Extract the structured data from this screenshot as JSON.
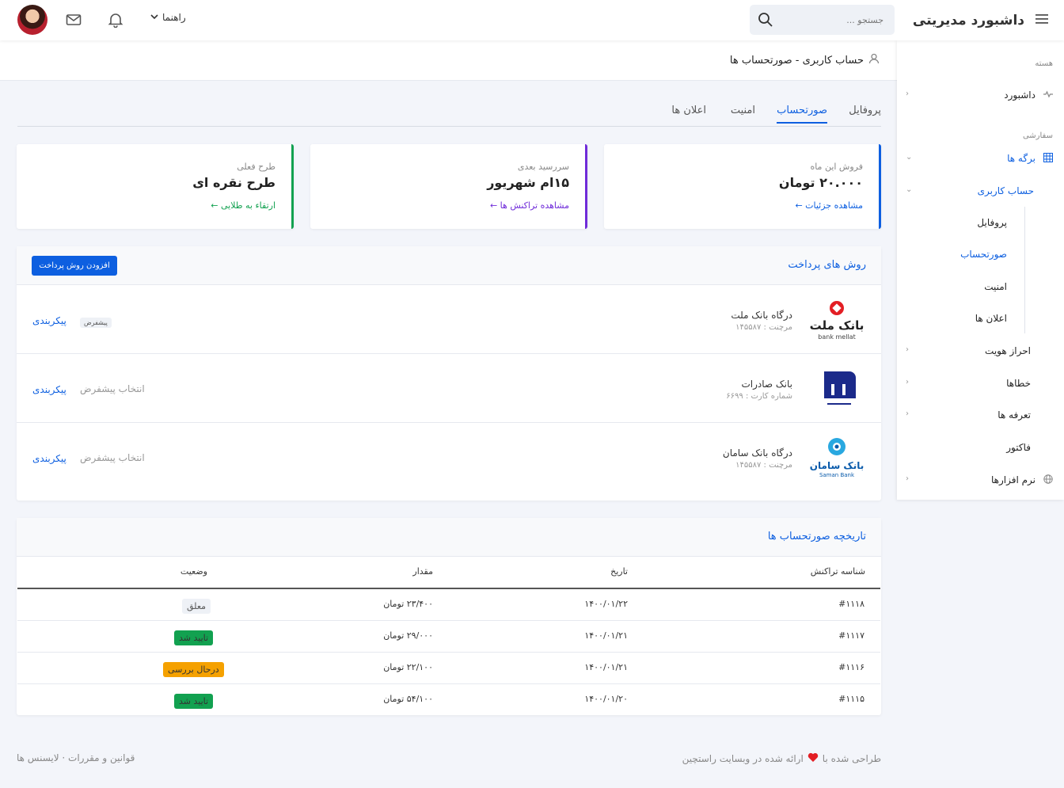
{
  "topbar": {
    "title": "داشبورد مدیریتی",
    "search_placeholder": "جستجو ...",
    "help_label": "راهنما"
  },
  "breadcrumb": "حساب کاربری - صورتحساب ها",
  "sidebar": {
    "section_core": "هسته",
    "section_custom": "سفارشی",
    "items": [
      {
        "label": "داشبورد"
      },
      {
        "label": "برگه ها"
      },
      {
        "label": "حساب کاربری"
      },
      {
        "label": "احراز هویت"
      },
      {
        "label": "خطاها"
      },
      {
        "label": "تعرفه ها"
      },
      {
        "label": "فاکتور"
      },
      {
        "label": "نرم افزارها"
      }
    ],
    "sub_items": [
      "پروفایل",
      "صورتحساب",
      "امنیت",
      "اعلان ها"
    ]
  },
  "tabs": [
    "پروفایل",
    "صورتحساب",
    "امنیت",
    "اعلان ها"
  ],
  "stats": [
    {
      "label": "فروش این ماه",
      "value": "۲۰.۰۰۰ تومان",
      "link": "مشاهده جزئیات ←",
      "color": "#0d5fe0"
    },
    {
      "label": "سررسید بعدی",
      "value": "۱۵ام شهریور",
      "link": "مشاهده تراکنش ها ←",
      "color": "#6f2bd9"
    },
    {
      "label": "طرح فعلی",
      "value": "طرح نقره ای",
      "link": "ارتقاء به طلایی ←",
      "color": "#12a150"
    }
  ],
  "payments": {
    "title": "روش های پرداخت",
    "add_button": "افزودن روش پرداخت",
    "rows": [
      {
        "name": "درگاه بانک ملت",
        "sub": "مرچنت : ۱۴۵۵۸۷",
        "default_label": "پیشفرض",
        "action": "پیکربندی",
        "logo_text": "بانک ملت",
        "logo_sub": "bank mellat"
      },
      {
        "name": "بانک صادرات",
        "sub": "شماره کارت : ۶۶۹۹",
        "default_label": "انتخاب پیشفرض",
        "action": "پیکربندی"
      },
      {
        "name": "درگاه بانک سامان",
        "sub": "مرچنت : ۱۴۵۵۸۷",
        "default_label": "انتخاب پیشفرض",
        "action": "پیکربندی",
        "logo_text": "بانک سامان",
        "logo_sub": "Saman Bank"
      }
    ]
  },
  "history": {
    "title": "تاریخچه صورتحساب ها",
    "columns": [
      "شناسه تراکنش",
      "تاریخ",
      "مقدار",
      "وضعیت"
    ],
    "rows": [
      {
        "id": "#۱۱۱۸",
        "date": "۱۴۰۰/۰۱/۲۲",
        "amount": "۲۳/۴۰۰ تومان",
        "status": "معلق",
        "status_color": "#eef1f6",
        "status_text_color": "#555"
      },
      {
        "id": "#۱۱۱۷",
        "date": "۱۴۰۰/۰۱/۲۱",
        "amount": "۲۹/۰۰۰ تومان",
        "status": "تایید شد",
        "status_color": "#12a150",
        "status_text_color": "#ffffff"
      },
      {
        "id": "#۱۱۱۶",
        "date": "۱۴۰۰/۰۱/۲۱",
        "amount": "۲۲/۱۰۰ تومان",
        "status": "درحال بررسی",
        "status_color": "#f5a100",
        "status_text_color": "#ffffff"
      },
      {
        "id": "#۱۱۱۵",
        "date": "۱۴۰۰/۰۱/۲۰",
        "amount": "۵۴/۱۰۰ تومان",
        "status": "تایید شد",
        "status_color": "#12a150",
        "status_text_color": "#ffffff"
      }
    ]
  },
  "footer": {
    "left": "قوانین و مقررات · لایسنس ها",
    "right_prefix": "طراحی شده با",
    "right_suffix": "ارائه شده در وبسایت راستچین"
  }
}
